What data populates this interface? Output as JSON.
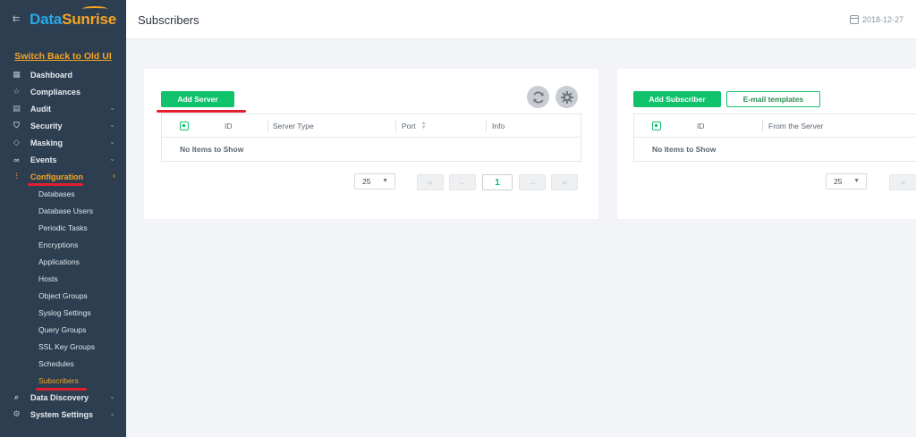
{
  "sidebar": {
    "logo": {
      "part1": "Data",
      "part2": "Sunrise"
    },
    "switch_link": "Switch Back to Old UI",
    "nav": [
      {
        "label": "Dashboard",
        "icon": "dashboard-icon",
        "glyph": "▦",
        "chevron": ""
      },
      {
        "label": "Compliances",
        "icon": "star-icon",
        "glyph": "☆",
        "chevron": ""
      },
      {
        "label": "Audit",
        "icon": "audit-icon",
        "glyph": "▤",
        "chevron": "⌄"
      },
      {
        "label": "Security",
        "icon": "shield-icon",
        "glyph": "⛉",
        "chevron": "⌄"
      },
      {
        "label": "Masking",
        "icon": "mask-icon",
        "glyph": "◇",
        "chevron": "⌄"
      },
      {
        "label": "Events",
        "icon": "binoculars-icon",
        "glyph": "∞",
        "chevron": "⌄"
      },
      {
        "label": "Configuration",
        "icon": "sliders-icon",
        "glyph": "⫶",
        "chevron": "‹"
      }
    ],
    "config_sub": [
      "Databases",
      "Database Users",
      "Periodic Tasks",
      "Encryptions",
      "Applications",
      "Hosts",
      "Object Groups",
      "Syslog Settings",
      "Query Groups",
      "SSL Key Groups",
      "Schedules",
      "Subscribers"
    ],
    "nav_bottom": [
      {
        "label": "Data Discovery",
        "icon": "search-icon",
        "glyph": "⌕",
        "chevron": "⌄"
      },
      {
        "label": "System Settings",
        "icon": "link-icon",
        "glyph": "⚙",
        "chevron": "⌄"
      }
    ]
  },
  "header": {
    "title": "Subscribers",
    "date": "2018-12-27"
  },
  "servers_panel": {
    "add_button": "Add Server",
    "columns": [
      "ID",
      "Server Type",
      "Port",
      "Info"
    ],
    "empty_text": "No Items to Show",
    "page_size": "25",
    "page": "1"
  },
  "subscribers_panel": {
    "add_button": "Add Subscriber",
    "templates_button": "E-mail templates",
    "columns": [
      "ID",
      "From the Server"
    ],
    "empty_text": "No Items to Show",
    "page_size": "25"
  },
  "colors": {
    "accent_green": "#11c26d",
    "sidebar_bg": "#2d3e50",
    "active_orange": "#f5a623",
    "annotation_red": "#e0202e"
  }
}
